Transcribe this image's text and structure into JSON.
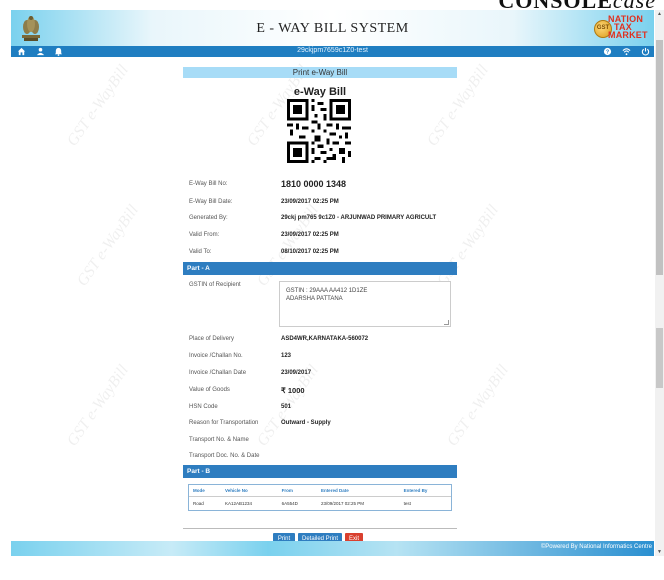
{
  "brand": {
    "name_bold": "CONSOLE",
    "name_light": "case"
  },
  "header": {
    "title": "E - WAY BILL SYSTEM",
    "gst_logo_lines": [
      "NATION",
      "TAX",
      "MARKET"
    ],
    "gst_coin": "GST"
  },
  "navbar": {
    "user_id": "29ckjpm7659c1Z0-test"
  },
  "sheet": {
    "print_title": "Print e-Way Bill",
    "heading": "e-Way Bill",
    "details": [
      {
        "label": "E-Way Bill No:",
        "value": "1810 0000 1348"
      },
      {
        "label": "E-Way Bill Date:",
        "value": "23/09/2017 02:25 PM"
      },
      {
        "label": "Generated By:",
        "value": "29ckj pm765 9c1Z0 - ARJUNWAD PRIMARY AGRICULT"
      },
      {
        "label": "Valid From:",
        "value": "23/09/2017 02:25 PM"
      },
      {
        "label": "Valid To:",
        "value": "08/10/2017 02:25 PM"
      }
    ],
    "part_a": {
      "title": "Part - A",
      "gstin_label": "GSTIN of Recipient",
      "gstin_line1": "GSTIN : 29AAA  AA412  1D1ZE",
      "gstin_line2": "ADARSHA PATTANA",
      "rows": [
        {
          "label": "Place of Delivery",
          "value": "ASD4WR,KARNATAKA-560072"
        },
        {
          "label": "Invoice /Challan No.",
          "value": "123"
        },
        {
          "label": "Invoice /Challan Date",
          "value": "23/09/2017"
        },
        {
          "label": "Value of Goods",
          "value": "₹ 1000"
        },
        {
          "label": "HSN Code",
          "value": "501"
        },
        {
          "label": "Reason for Transportation",
          "value": "Outward - Supply"
        },
        {
          "label": "Transport No. & Name",
          "value": ""
        },
        {
          "label": "Transport Doc. No. & Date",
          "value": ""
        }
      ]
    },
    "part_b": {
      "title": "Part - B",
      "columns": [
        "Mode",
        "Vehicle No",
        "From",
        "Entered Date",
        "Entered By"
      ],
      "rows": [
        [
          "Road",
          "KA12AB1234",
          "6A554D",
          "23/09/2017 02:25 PM",
          "test"
        ]
      ]
    },
    "buttons": {
      "print": "Print",
      "detailed_print": "Detailed Print",
      "exit": "Exit"
    }
  },
  "watermark_text": "GST e-WayBill",
  "footer": {
    "powered_by": "©Powered By National Informatics Centre"
  },
  "colors": {
    "nav_blue": "#1f7ec1",
    "section_blue": "#2e7dc0",
    "print_title_bg": "#a7dcf7",
    "exit_red": "#d9402f"
  }
}
